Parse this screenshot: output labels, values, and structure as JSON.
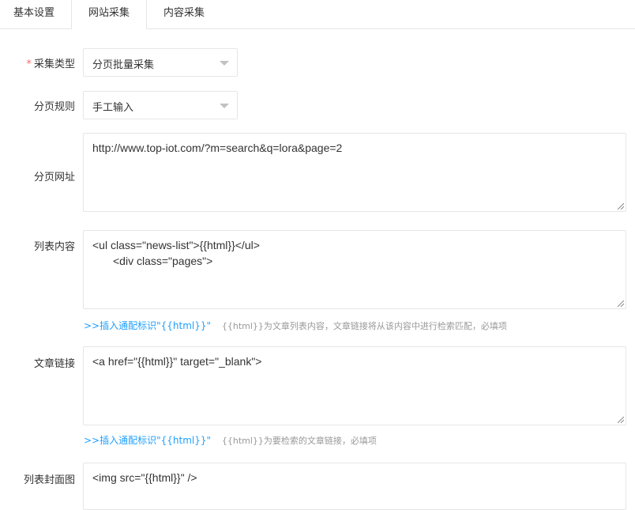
{
  "tabs": [
    {
      "label": "基本设置"
    },
    {
      "label": "网站采集"
    },
    {
      "label": "内容采集"
    }
  ],
  "form": {
    "required_mark": "*",
    "collect_type": {
      "label": "采集类型",
      "value": "分页批量采集"
    },
    "page_rule": {
      "label": "分页规则",
      "value": "手工输入"
    },
    "page_url": {
      "label": "分页网址",
      "value": "http://www.top-iot.com/?m=search&q=lora&page=2"
    },
    "list_content": {
      "label": "列表内容",
      "line1": "<ul class=\"news-list\">{{html}}</ul>",
      "line2": "<div class=\"pages\">",
      "insert_link": ">>插入通配标识\"{{html}}\"",
      "hint": "{{html}}为文章列表内容，文章链接将从该内容中进行检索匹配，必填项"
    },
    "article_link": {
      "label": "文章链接",
      "value": "<a href=\"{{html}}\" target=\"_blank\">",
      "insert_link": ">>插入通配标识\"{{html}}\"",
      "hint": "{{html}}为要检索的文章链接，必填项"
    },
    "list_cover": {
      "label": "列表封面图",
      "value": "<img src=\"{{html}}\" />"
    }
  }
}
